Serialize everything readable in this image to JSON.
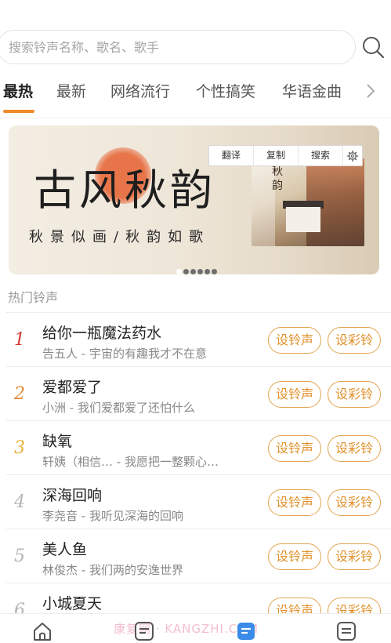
{
  "search": {
    "placeholder": "搜索铃声名称、歌名、歌手"
  },
  "tabs": [
    {
      "label": "最热",
      "active": true
    },
    {
      "label": "最新"
    },
    {
      "label": "网络流行"
    },
    {
      "label": "个性搞笑"
    },
    {
      "label": "华语金曲"
    }
  ],
  "banner": {
    "title": "古风秋韵",
    "subtitle": "秋景似画/秋韵如歌",
    "album_text": "秋韵",
    "slide_count": 6,
    "active_slide": 0
  },
  "overlay_toolbar": {
    "translate": "翻译",
    "copy": "复制",
    "search": "搜索"
  },
  "section": {
    "title": "热门铃声"
  },
  "colors": {
    "accent": "#f0892a",
    "pill": "#e0912c",
    "rank1": "#d2382f",
    "rank2": "#e88a34",
    "rank3": "#e8b23c",
    "rank_other": "#b5b5b5"
  },
  "buttons": {
    "set_ringtone": "设铃声",
    "set_crbt": "设彩铃"
  },
  "songs": [
    {
      "rank": "1",
      "title": "给你一瓶魔法药水",
      "subtitle": "告五人 - 宇宙的有趣我才不在意"
    },
    {
      "rank": "2",
      "title": "爱都爱了",
      "subtitle": "小洲 - 我们爱都爱了还怕什么"
    },
    {
      "rank": "3",
      "title": "缺氧",
      "subtitle": "轩姨（相信…  - 我愿把一整颗心…"
    },
    {
      "rank": "4",
      "title": "深海回响",
      "subtitle": "李尧音 - 我听见深海的回响"
    },
    {
      "rank": "5",
      "title": "美人鱼",
      "subtitle": "林俊杰 - 我们两的安逸世界"
    },
    {
      "rank": "6",
      "title": "小城夏天",
      "subtitle": ""
    }
  ],
  "bottom_nav": {
    "items": [
      "home-icon",
      "list-icon",
      "ringtone-icon",
      "document-icon"
    ],
    "active_index": 2,
    "watermark": "康复网 · KANGZHI.COM"
  }
}
